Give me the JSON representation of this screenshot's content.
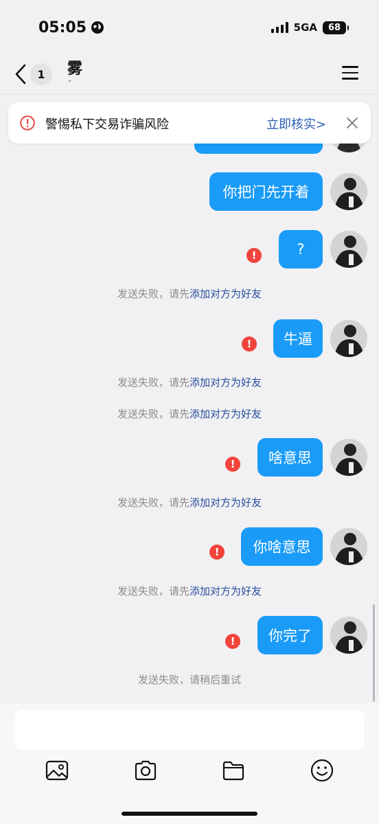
{
  "status_bar": {
    "time": "05:05",
    "network": "5GA",
    "battery": "68"
  },
  "header": {
    "title": "雾",
    "subtitle": "-",
    "unread_count": "1"
  },
  "warning_banner": {
    "text": "警惕私下交易诈骗风险",
    "action": "立即核实>"
  },
  "messages": [
    {
      "text": "你把门先开着",
      "failed": false
    },
    {
      "text": "?",
      "failed": true
    },
    {
      "text": "牛逼",
      "failed": true
    },
    {
      "text": "啥意思",
      "failed": true
    },
    {
      "text": "你啥意思",
      "failed": true
    },
    {
      "text": "你完了",
      "failed": true
    }
  ],
  "system_notes": {
    "fail_prefix": "发送失败，请先",
    "fail_link": "添加对方为好友",
    "retry": "发送失败，请稍后重试"
  },
  "input": {
    "placeholder": ""
  },
  "toolbar": [
    "image-icon",
    "camera-icon",
    "folder-icon",
    "emoji-icon"
  ],
  "colors": {
    "bubble": "#1a9bf7",
    "error": "#f0443c",
    "link": "#2a4f9c"
  }
}
